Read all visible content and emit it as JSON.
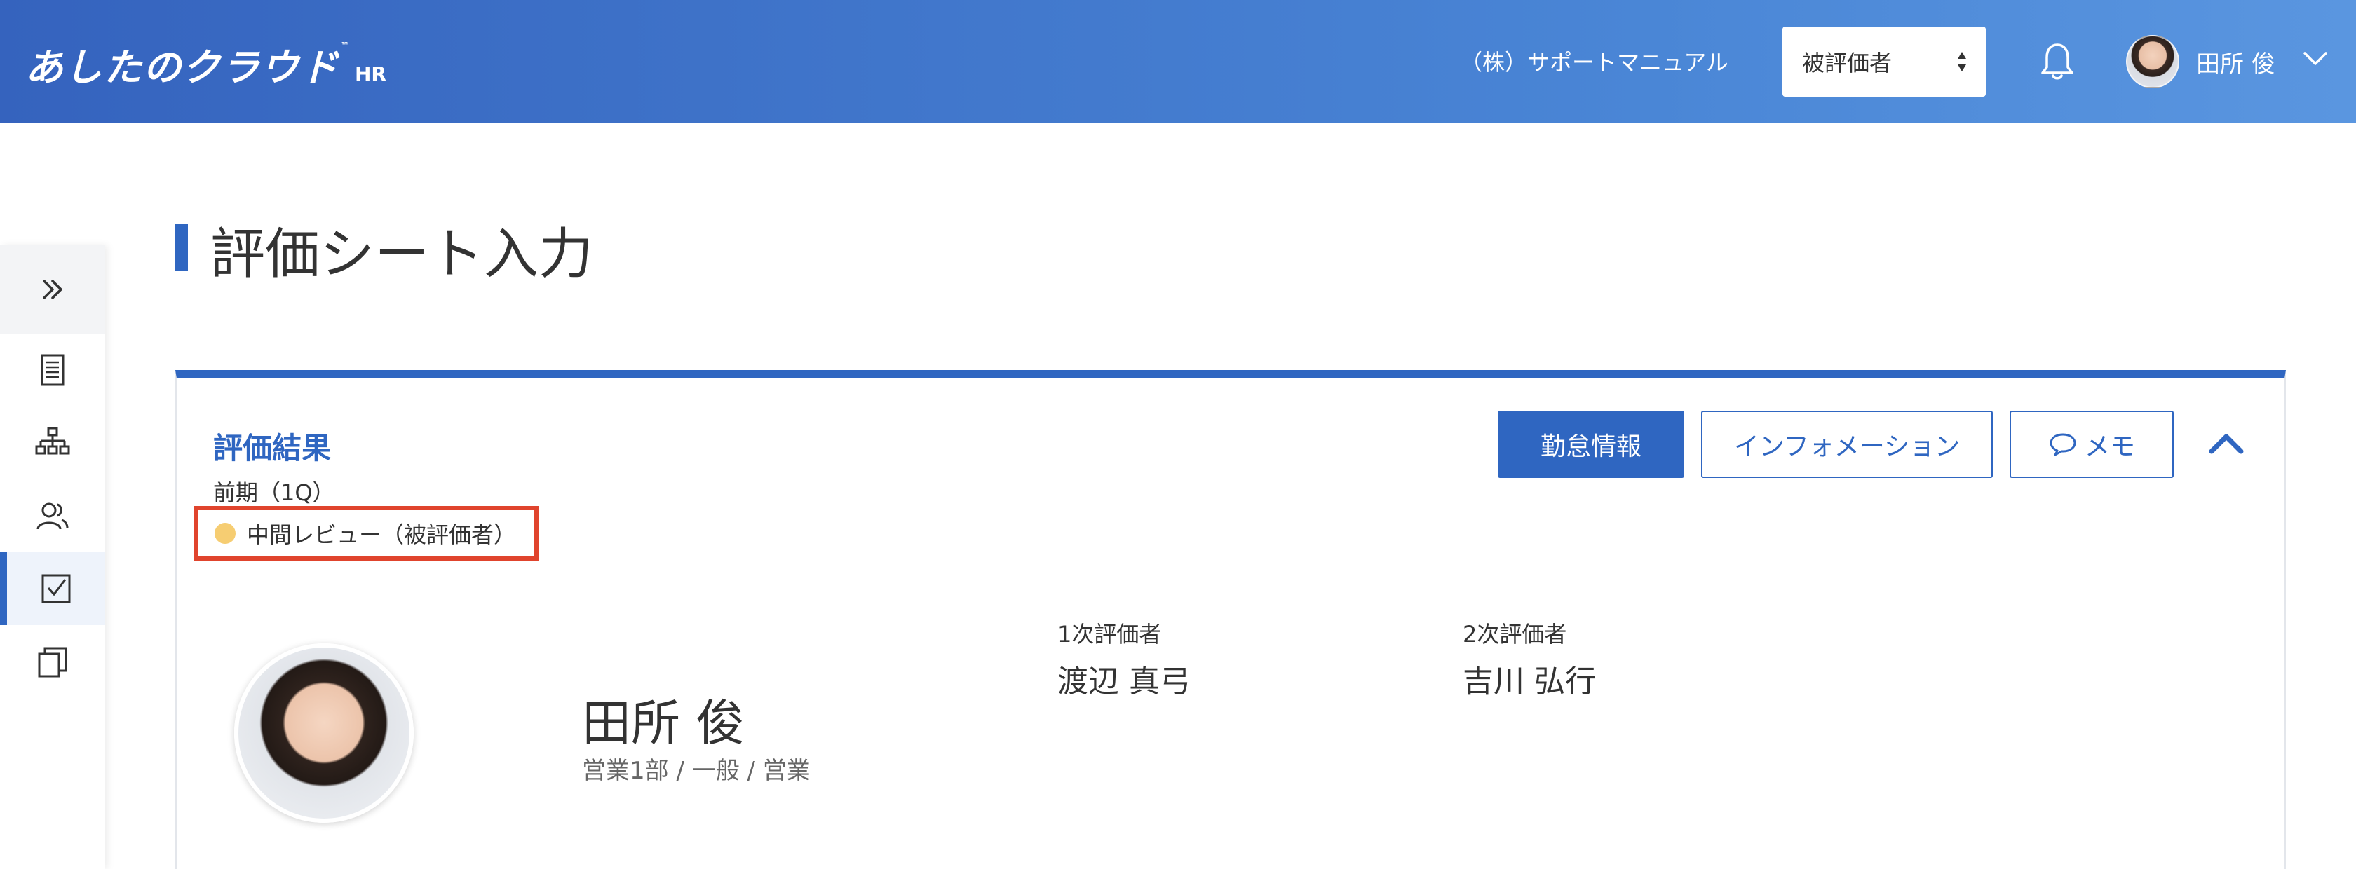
{
  "header": {
    "logo_text": "あしたのクラウド",
    "logo_tm": "™",
    "logo_suffix": "HR",
    "company": "（株）サポートマニュアル",
    "role_select_value": "被評価者",
    "user_name": "田所 俊",
    "bell_icon": "bell-icon",
    "brand_color": "#3563be"
  },
  "sidebar": {
    "toggle_icon": "double-chevron-right-icon",
    "items": [
      {
        "icon": "document-icon",
        "active": false
      },
      {
        "icon": "org-chart-icon",
        "active": false
      },
      {
        "icon": "users-icon",
        "active": false
      },
      {
        "icon": "checkbox-icon",
        "active": true
      },
      {
        "icon": "copy-icon",
        "active": false
      }
    ]
  },
  "page": {
    "title": "評価シート入力"
  },
  "card": {
    "title": "評価結果",
    "period": "前期（1Q）",
    "status": "中間レビュー（被評価者）",
    "status_color": "#f6cd72",
    "buttons": {
      "attendance": "勤怠情報",
      "information": "インフォメーション",
      "memo": "メモ"
    },
    "person": {
      "name": "田所 俊",
      "department": "営業1部 / 一般 / 営業"
    },
    "evaluators": [
      {
        "label": "1次評価者",
        "name": "渡辺 真弓"
      },
      {
        "label": "2次評価者",
        "name": "吉川 弘行"
      }
    ]
  }
}
